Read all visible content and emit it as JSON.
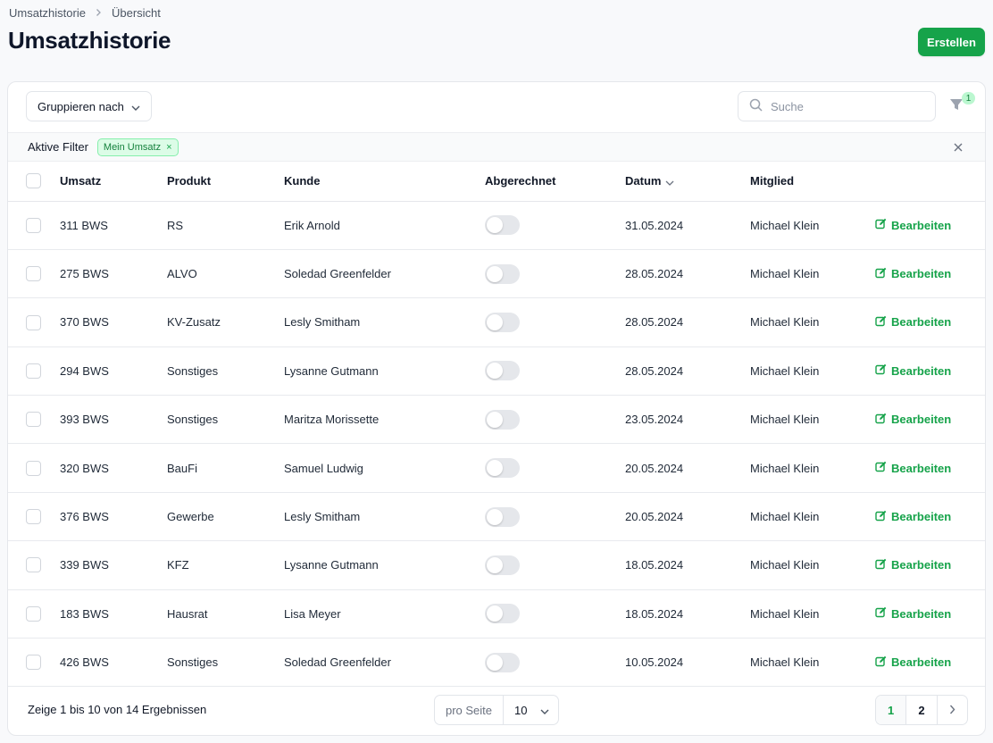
{
  "breadcrumb": {
    "items": [
      "Umsatzhistorie",
      "Übersicht"
    ]
  },
  "page": {
    "title": "Umsatzhistorie",
    "create_label": "Erstellen"
  },
  "toolbar": {
    "group_label": "Gruppieren nach",
    "search_placeholder": "Suche",
    "search_value": "",
    "filter_count": "1"
  },
  "active_filters": {
    "label": "Aktive Filter",
    "chip": "Mein Umsatz"
  },
  "table": {
    "headers": {
      "umsatz": "Umsatz",
      "produkt": "Produkt",
      "kunde": "Kunde",
      "abgerechnet": "Abgerechnet",
      "datum": "Datum",
      "mitglied": "Mitglied"
    },
    "edit_label": "Bearbeiten",
    "rows": [
      {
        "umsatz": "311 BWS",
        "produkt": "RS",
        "kunde": "Erik Arnold",
        "abgerechnet": false,
        "datum": "31.05.2024",
        "mitglied": "Michael Klein"
      },
      {
        "umsatz": "275 BWS",
        "produkt": "ALVO",
        "kunde": "Soledad Greenfelder",
        "abgerechnet": false,
        "datum": "28.05.2024",
        "mitglied": "Michael Klein"
      },
      {
        "umsatz": "370 BWS",
        "produkt": "KV-Zusatz",
        "kunde": "Lesly Smitham",
        "abgerechnet": false,
        "datum": "28.05.2024",
        "mitglied": "Michael Klein"
      },
      {
        "umsatz": "294 BWS",
        "produkt": "Sonstiges",
        "kunde": "Lysanne Gutmann",
        "abgerechnet": false,
        "datum": "28.05.2024",
        "mitglied": "Michael Klein"
      },
      {
        "umsatz": "393 BWS",
        "produkt": "Sonstiges",
        "kunde": "Maritza Morissette",
        "abgerechnet": false,
        "datum": "23.05.2024",
        "mitglied": "Michael Klein"
      },
      {
        "umsatz": "320 BWS",
        "produkt": "BauFi",
        "kunde": "Samuel Ludwig",
        "abgerechnet": false,
        "datum": "20.05.2024",
        "mitglied": "Michael Klein"
      },
      {
        "umsatz": "376 BWS",
        "produkt": "Gewerbe",
        "kunde": "Lesly Smitham",
        "abgerechnet": false,
        "datum": "20.05.2024",
        "mitglied": "Michael Klein"
      },
      {
        "umsatz": "339 BWS",
        "produkt": "KFZ",
        "kunde": "Lysanne Gutmann",
        "abgerechnet": false,
        "datum": "18.05.2024",
        "mitglied": "Michael Klein"
      },
      {
        "umsatz": "183 BWS",
        "produkt": "Hausrat",
        "kunde": "Lisa Meyer",
        "abgerechnet": false,
        "datum": "18.05.2024",
        "mitglied": "Michael Klein"
      },
      {
        "umsatz": "426 BWS",
        "produkt": "Sonstiges",
        "kunde": "Soledad Greenfelder",
        "abgerechnet": false,
        "datum": "10.05.2024",
        "mitglied": "Michael Klein"
      }
    ]
  },
  "footer": {
    "results_text": "Zeige 1 bis 10 von 14 Ergebnissen",
    "per_page_label": "pro Seite",
    "per_page_value": "10",
    "pages": [
      "1",
      "2"
    ],
    "current_page": "1"
  },
  "colors": {
    "accent": "#16a34a",
    "chip_bg": "#dcfce7"
  }
}
